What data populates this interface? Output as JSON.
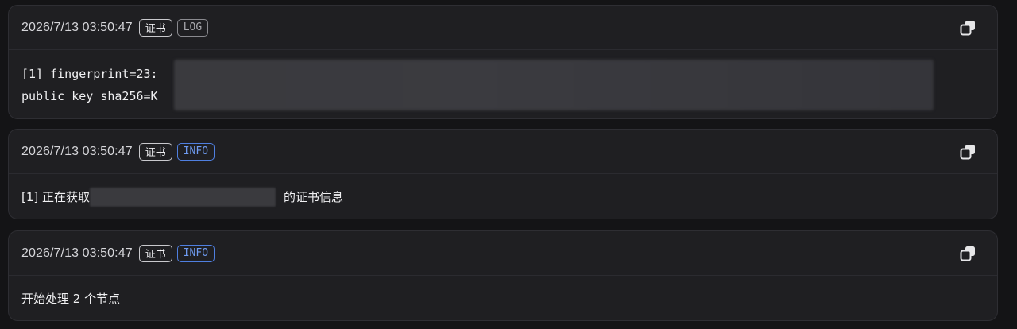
{
  "entries": [
    {
      "timestamp": "2026/7/13 03:50:47",
      "tags": [
        "证书",
        "LOG"
      ],
      "lines": [
        "[1] fingerprint=23:",
        "public_key_sha256=K"
      ]
    },
    {
      "timestamp": "2026/7/13 03:50:47",
      "tags": [
        "证书",
        "INFO"
      ],
      "message_prefix": "[1] 正在获取",
      "message_suffix": "的证书信息"
    },
    {
      "timestamp": "2026/7/13 03:50:47",
      "tags": [
        "证书",
        "INFO"
      ],
      "message": "开始处理 2 个节点"
    }
  ],
  "icons": {
    "copy": "copy-icon"
  },
  "colors": {
    "info": "#4f7fe0",
    "log": "#8a8a8f",
    "cert": "#c9c9cd"
  }
}
